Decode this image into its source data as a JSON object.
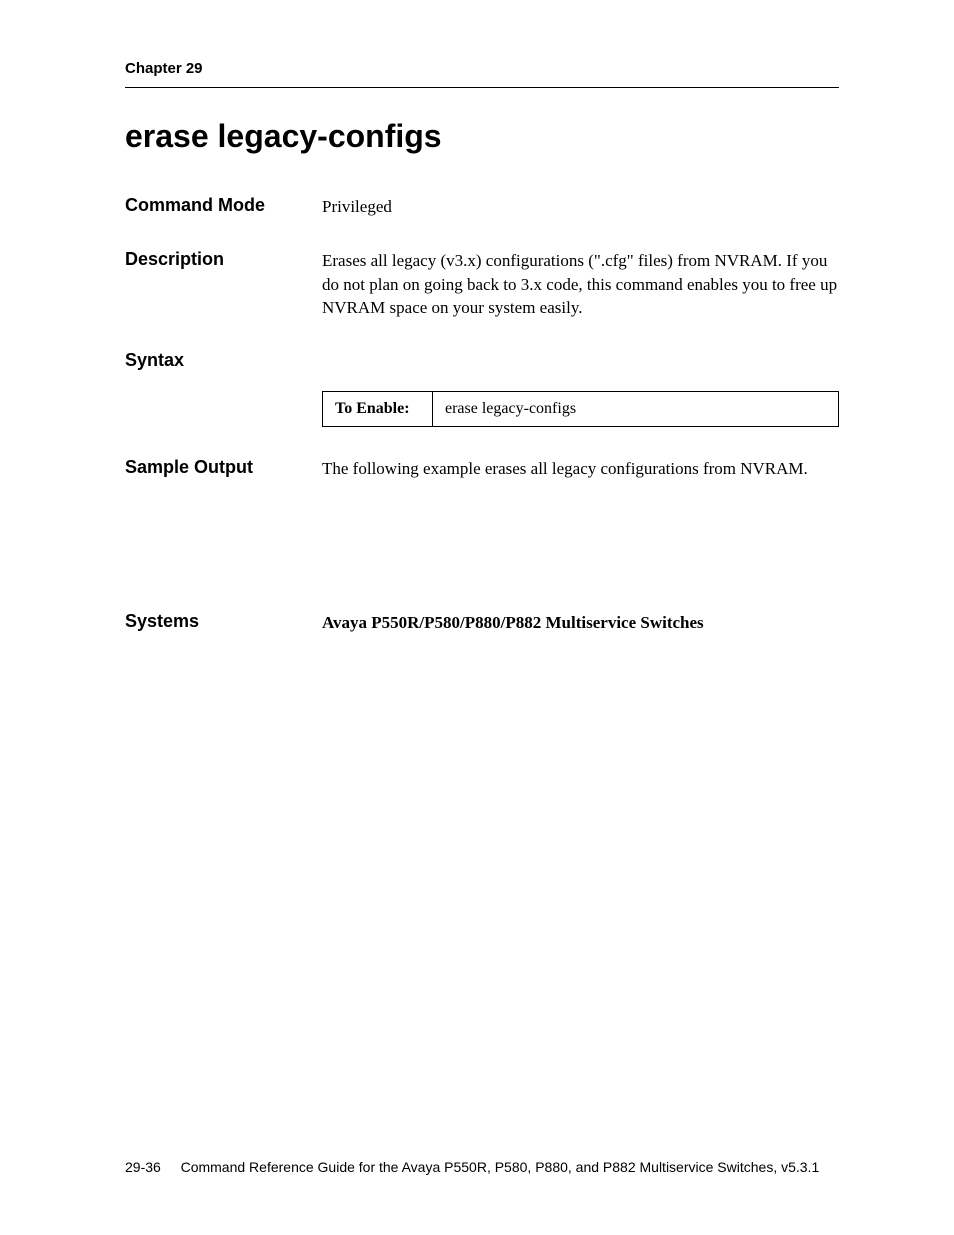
{
  "header": {
    "chapter": "Chapter 29"
  },
  "title": "erase legacy-configs",
  "sections": {
    "command_mode": {
      "label": "Command Mode",
      "value": "Privileged"
    },
    "description": {
      "label": "Description",
      "value": "Erases all legacy (v3.x) configurations (\".cfg\" files) from NVRAM. If you do not plan on going back to 3.x code, this command enables you to free up NVRAM space on your system easily."
    },
    "syntax": {
      "label": "Syntax",
      "to_enable_label": "To Enable:",
      "command": "erase legacy-configs"
    },
    "sample_output": {
      "label": "Sample Output",
      "value": "The following example erases all legacy configurations from NVRAM."
    },
    "systems": {
      "label": "Systems",
      "value": "Avaya P550R/P580/P880/P882 Multiservice Switches"
    }
  },
  "footer": {
    "page_number": "29-36",
    "guide_title": "Command Reference Guide for the Avaya P550R, P580, P880, and P882 Multiservice Switches, v5.3.1"
  }
}
